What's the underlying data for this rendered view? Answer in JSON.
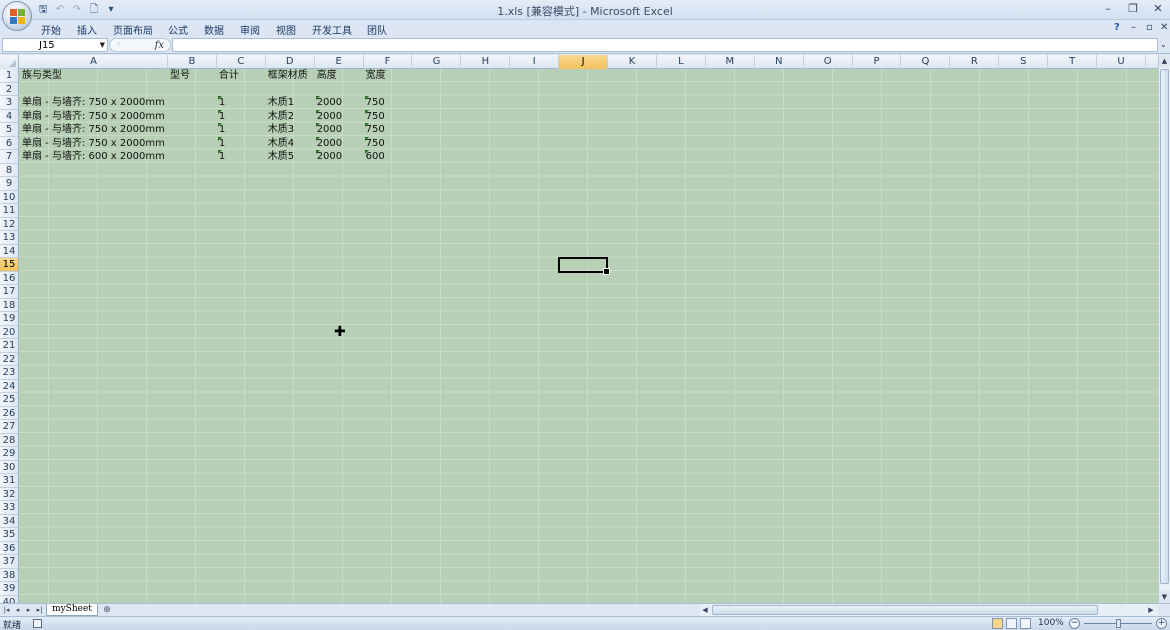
{
  "window": {
    "title": "1.xls  [兼容模式] - Microsoft Excel",
    "minimize": "–",
    "restore": "❐",
    "close": "✕"
  },
  "qat": {
    "save": "🖫",
    "undo": "↶",
    "redo": "↷",
    "print_preview": "🗋",
    "more": "▾"
  },
  "ribbon": {
    "tabs": [
      "开始",
      "插入",
      "页面布局",
      "公式",
      "数据",
      "审阅",
      "视图",
      "开发工具",
      "团队"
    ],
    "help": "?",
    "doc_minimize": "–",
    "doc_restore": "▫",
    "doc_close": "✕"
  },
  "formula_bar": {
    "name_box": "J15",
    "fx": "fx",
    "value": ""
  },
  "grid": {
    "columns": [
      "A",
      "B",
      "C",
      "D",
      "E",
      "F",
      "G",
      "H",
      "I",
      "J",
      "K",
      "L",
      "M",
      "N",
      "O",
      "P",
      "Q",
      "R",
      "S",
      "T",
      "U"
    ],
    "active_column": "J",
    "active_row": 15,
    "active_cell": "J15",
    "rows": [
      "1",
      "2",
      "3",
      "4",
      "5",
      "6",
      "7",
      "8",
      "9",
      "10",
      "11",
      "12",
      "13",
      "14",
      "15",
      "16",
      "17",
      "18",
      "19",
      "20",
      "21",
      "22",
      "23",
      "24",
      "25",
      "26",
      "27",
      "28",
      "29",
      "30",
      "31",
      "32",
      "33",
      "34",
      "35",
      "36",
      "37",
      "38",
      "39",
      "40"
    ],
    "cells": {
      "A1": "族与类型",
      "B1": "型号",
      "C1": "合计",
      "D1": "框架材质",
      "E1": "高度",
      "F1": "宽度",
      "A3": "单扇 - 与墙齐: 750 x 2000mm",
      "C3": "1",
      "D3": "木质1",
      "E3": "2000",
      "F3": "750",
      "A4": "单扇 - 与墙齐: 750 x 2000mm",
      "C4": "1",
      "D4": "木质2",
      "E4": "2000",
      "F4": "750",
      "A5": "单扇 - 与墙齐: 750 x 2000mm",
      "C5": "1",
      "D5": "木质3",
      "E5": "2000",
      "F5": "750",
      "A6": "单扇 - 与墙齐: 750 x 2000mm",
      "C6": "1",
      "D6": "木质4",
      "E6": "2000",
      "F6": "750",
      "A7": "单扇 - 与墙齐: 600 x 2000mm",
      "C7": "1",
      "D7": "木质5",
      "E7": "2000",
      "F7": "600"
    },
    "text_as_number_flags": [
      "C3",
      "E3",
      "F3",
      "C4",
      "E4",
      "F4",
      "C5",
      "E5",
      "F5",
      "C6",
      "E6",
      "F6",
      "C7",
      "E7",
      "F7"
    ]
  },
  "sheets": {
    "tabs": [
      "mySheet"
    ],
    "active": "mySheet"
  },
  "status_bar": {
    "status": "就绪",
    "zoom": "100%",
    "zoom_out": "−",
    "zoom_in": "+"
  },
  "colors": {
    "grid_bg": "#b7cfb5",
    "gridline": "#c9dcc7",
    "active_header": "#f7d68a"
  }
}
